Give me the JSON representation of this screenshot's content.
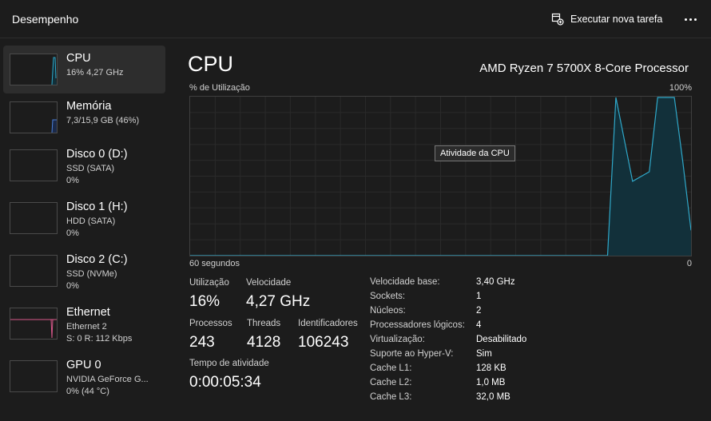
{
  "header": {
    "title": "Desempenho",
    "run_task_label": "Executar nova tarefa"
  },
  "sidebar": {
    "items": [
      {
        "name": "CPU",
        "sub1": "16% 4,27 GHz",
        "sub2": ""
      },
      {
        "name": "Memória",
        "sub1": "7,3/15,9 GB (46%)",
        "sub2": ""
      },
      {
        "name": "Disco 0 (D:)",
        "sub1": "SSD (SATA)",
        "sub2": "0%"
      },
      {
        "name": "Disco 1 (H:)",
        "sub1": "HDD (SATA)",
        "sub2": "0%"
      },
      {
        "name": "Disco 2 (C:)",
        "sub1": "SSD (NVMe)",
        "sub2": "0%"
      },
      {
        "name": "Ethernet",
        "sub1": "Ethernet 2",
        "sub2": "S: 0 R: 112 Kbps"
      },
      {
        "name": "GPU 0",
        "sub1": "NVIDIA GeForce G...",
        "sub2": "0% (44 °C)"
      }
    ]
  },
  "main": {
    "title": "CPU",
    "processor": "AMD Ryzen 7 5700X 8-Core Processor",
    "graph_label": "% de Utilização",
    "graph_max": "100%",
    "graph_time": "60 segundos",
    "graph_min": "0",
    "tooltip": "Atividade da CPU",
    "stats": {
      "util_label": "Utilização",
      "util_value": "16%",
      "speed_label": "Velocidade",
      "speed_value": "4,27 GHz",
      "proc_label": "Processos",
      "proc_value": "243",
      "threads_label": "Threads",
      "threads_value": "4128",
      "handles_label": "Identificadores",
      "handles_value": "106243",
      "uptime_label": "Tempo de atividade",
      "uptime_value": "0:00:05:34"
    },
    "info": [
      {
        "k": "Velocidade base:",
        "v": "3,40 GHz"
      },
      {
        "k": "Sockets:",
        "v": "1"
      },
      {
        "k": "Núcleos:",
        "v": "2"
      },
      {
        "k": "Processadores lógicos:",
        "v": "4"
      },
      {
        "k": "Virtualização:",
        "v": "Desabilitado"
      },
      {
        "k": "Suporte ao Hyper-V:",
        "v": "Sim"
      },
      {
        "k": "Cache L1:",
        "v": "128 KB"
      },
      {
        "k": "Cache L2:",
        "v": "1,0 MB"
      },
      {
        "k": "Cache L3:",
        "v": "32,0 MB"
      }
    ]
  },
  "chart_data": {
    "type": "area",
    "x": [
      60,
      50,
      40,
      30,
      20,
      15,
      12,
      10,
      9,
      7,
      5,
      4,
      3,
      2,
      1,
      0
    ],
    "values": [
      0,
      0,
      0,
      0,
      0,
      0,
      0,
      0,
      100,
      47,
      53,
      100,
      100,
      100,
      60,
      16
    ],
    "ylim": [
      0,
      100
    ],
    "colors": {
      "line": "#2fa8c9",
      "fill": "#12303a",
      "grid": "#2a2a2a"
    }
  }
}
